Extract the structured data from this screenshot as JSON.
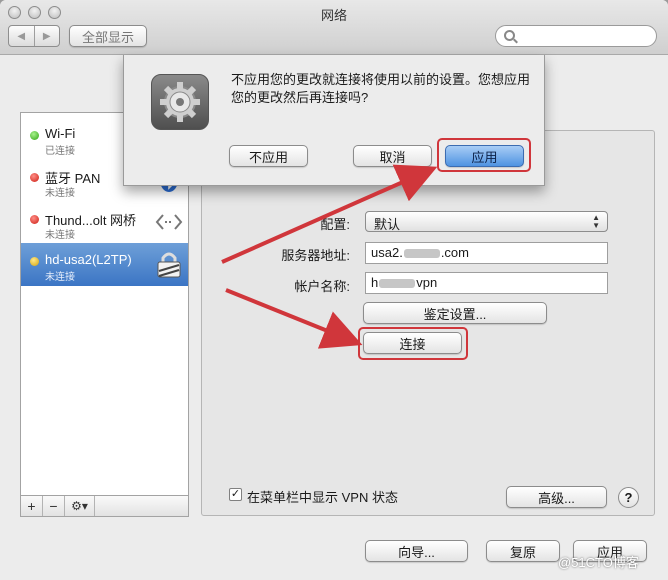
{
  "window": {
    "title": "网络"
  },
  "toolbar": {
    "back_label": "◀",
    "forward_label": "▶",
    "show_all_label": "全部显示",
    "search_placeholder": ""
  },
  "sidebar": {
    "items": [
      {
        "name": "Wi-Fi",
        "status": "已连接",
        "dot": "green",
        "icon": "wifi-icon"
      },
      {
        "name": "蓝牙 PAN",
        "status": "未连接",
        "dot": "red",
        "icon": "bluetooth-icon"
      },
      {
        "name": "Thund...olt 网桥",
        "status": "未连接",
        "dot": "red",
        "icon": "thunderbolt-bridge-icon"
      },
      {
        "name": "hd-usa2(L2TP)",
        "status": "未连接",
        "dot": "yellow",
        "icon": "vpn-lock-icon",
        "selected": true
      }
    ],
    "footer": {
      "add": "+",
      "remove": "−",
      "gear": "⚙▾"
    }
  },
  "sheet": {
    "message": "不应用您的更改就连接将使用以前的设置。您想应用您的更改然后再连接吗?",
    "dont_apply_label": "不应用",
    "cancel_label": "取消",
    "apply_label": "应用"
  },
  "vpn": {
    "config_label": "配置:",
    "config_value": "默认",
    "server_label": "服务器地址:",
    "server_prefix": "usa2.",
    "server_suffix": ".com",
    "account_label": "帐户名称:",
    "account_prefix": "h",
    "account_suffix": "vpn",
    "auth_button": "鉴定设置...",
    "connect_button": "连接",
    "show_vpn_label": "在菜单栏中显示 VPN 状态",
    "show_vpn_checked": "✓",
    "advanced_button": "高级...",
    "help": "?"
  },
  "bottom": {
    "assist_button": "向导...",
    "revert_button": "复原",
    "apply_button": "应用"
  },
  "watermark": "@51CTO博客",
  "colors": {
    "annotation": "#d0363b",
    "selection": "#3b75c4",
    "default_button": "#4f93e2"
  }
}
